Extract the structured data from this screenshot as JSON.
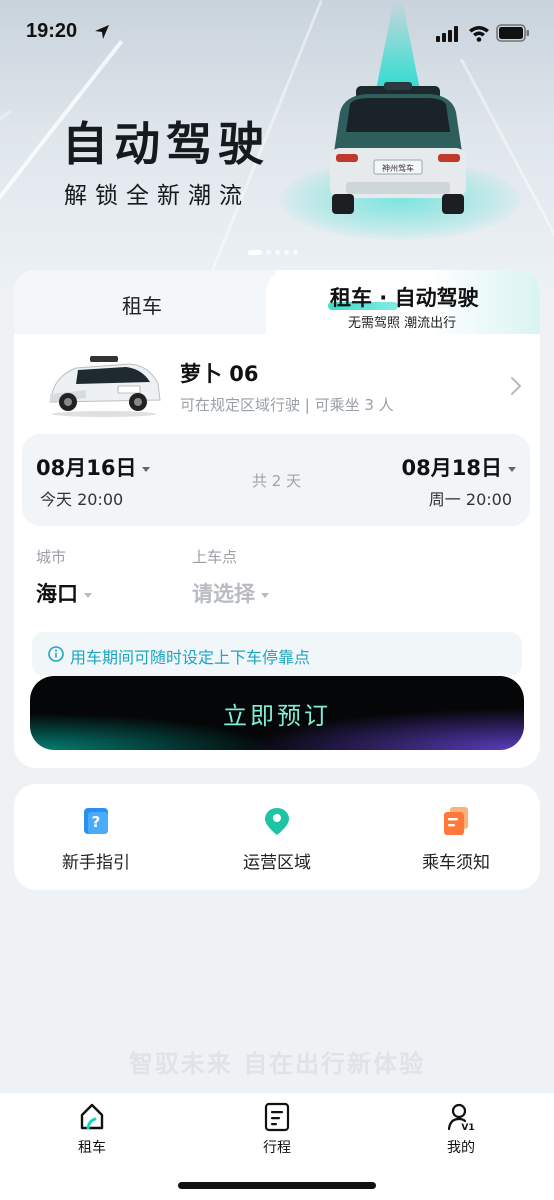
{
  "status_bar": {
    "time": "19:20"
  },
  "hero": {
    "title": "自动驾驶",
    "subtitle": "解锁全新潮流",
    "car_plate": "神州驾车",
    "pager_count": 5,
    "pager_active_index": 0
  },
  "tabs": {
    "left_label": "租车",
    "right_title": "租车 · 自动驾驶",
    "right_subtitle": "无需驾照 潮流出行",
    "active": "right"
  },
  "vehicle": {
    "name": "萝卜 06",
    "description": "可在规定区域行驶 | 可乘坐 3 人"
  },
  "dates": {
    "start_date": "08月16日",
    "start_sub": "今天 20:00",
    "duration": "共 2 天",
    "end_date": "08月18日",
    "end_sub": "周一 20:00"
  },
  "location": {
    "city_label": "城市",
    "city_value": "海口",
    "pickup_label": "上车点",
    "pickup_placeholder": "请选择"
  },
  "notice": {
    "text": "用车期间可随时设定上下车停靠点"
  },
  "book_button": {
    "label": "立即预订"
  },
  "shortcuts": [
    {
      "label": "新手指引",
      "icon": "question-icon"
    },
    {
      "label": "运营区域",
      "icon": "location-pin-icon"
    },
    {
      "label": "乘车须知",
      "icon": "notice-doc-icon"
    }
  ],
  "slogan": "智驭未来 自在出行新体验",
  "tabbar": [
    {
      "label": "租车",
      "icon": "car-home-icon",
      "active": true
    },
    {
      "label": "行程",
      "icon": "trip-list-icon",
      "active": false
    },
    {
      "label": "我的",
      "icon": "user-v1-icon",
      "active": false
    }
  ],
  "colors": {
    "accent_teal": "#19d6c4",
    "notice_blue": "#1da5c2",
    "button_bg": "#050607",
    "button_text": "#7ff0d8"
  }
}
